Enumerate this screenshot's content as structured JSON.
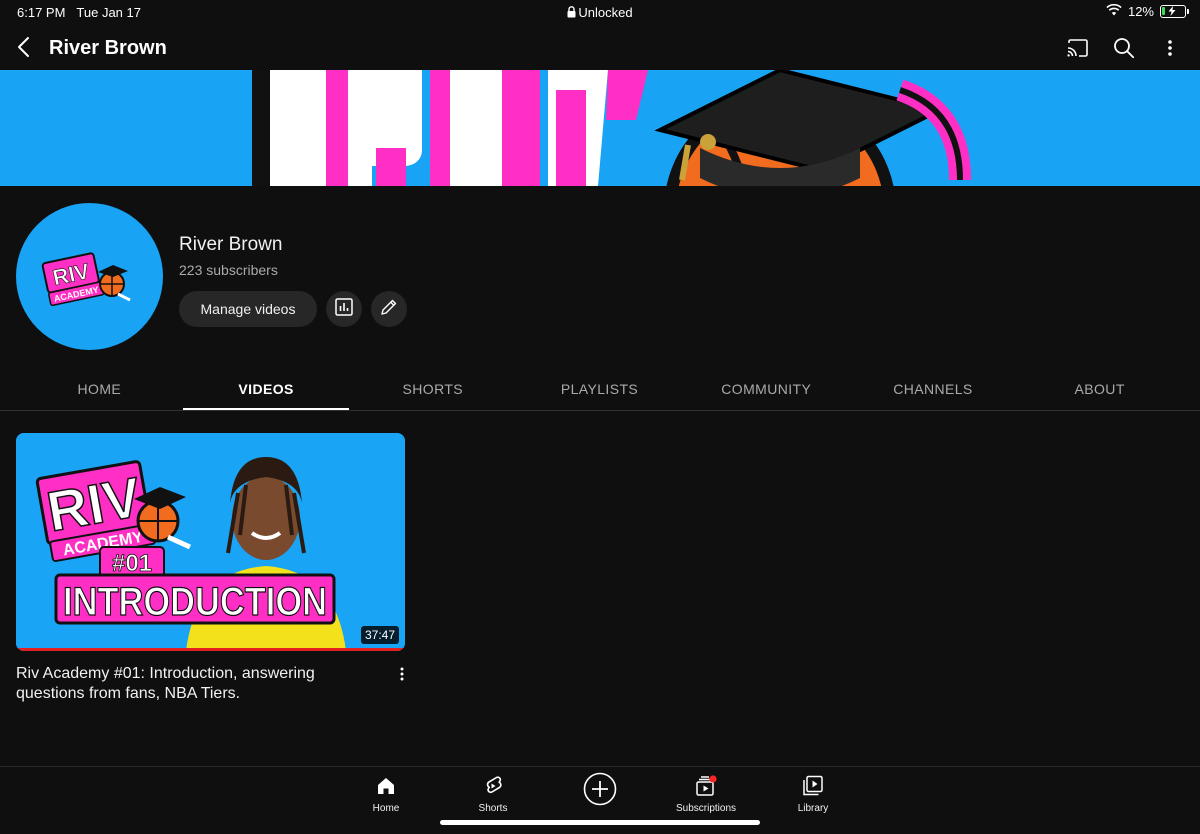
{
  "status_bar": {
    "time": "6:17 PM",
    "date": "Tue Jan 17",
    "center": "Unlocked",
    "battery": "12%",
    "battery_level": 0.12
  },
  "appbar": {
    "title": "River Brown",
    "icons": [
      "back-icon",
      "cast-icon",
      "search-icon",
      "more-vert-icon"
    ]
  },
  "channel": {
    "name": "River Brown",
    "subscribers": "223 subscribers",
    "manage_label": "Manage videos",
    "avatar_logo_line1": "RIV",
    "avatar_logo_line2": "ACADEMY"
  },
  "tabs": [
    {
      "label": "HOME",
      "active": false
    },
    {
      "label": "VIDEOS",
      "active": true
    },
    {
      "label": "SHORTS",
      "active": false
    },
    {
      "label": "PLAYLISTS",
      "active": false
    },
    {
      "label": "COMMUNITY",
      "active": false
    },
    {
      "label": "CHANNELS",
      "active": false
    },
    {
      "label": "ABOUT",
      "active": false
    }
  ],
  "video": {
    "title": "Riv Academy #01: Introduction, answering questions from fans, NBA Tiers.",
    "duration": "37:47",
    "thumb_text_riv": "RIV",
    "thumb_text_academy": "ACADEMY",
    "thumb_text_number": "#01",
    "thumb_text_intro": "INTRODUCTION",
    "watched_fraction": 1.0
  },
  "bottom_nav": {
    "home": "Home",
    "shorts": "Shorts",
    "subscriptions": "Subscriptions",
    "library": "Library"
  },
  "colors": {
    "background": "#0f0f0f",
    "banner_blue": "#18a3f5",
    "magenta": "#ff2ec4",
    "progress_red": "#e32020",
    "chip": "#272727"
  }
}
